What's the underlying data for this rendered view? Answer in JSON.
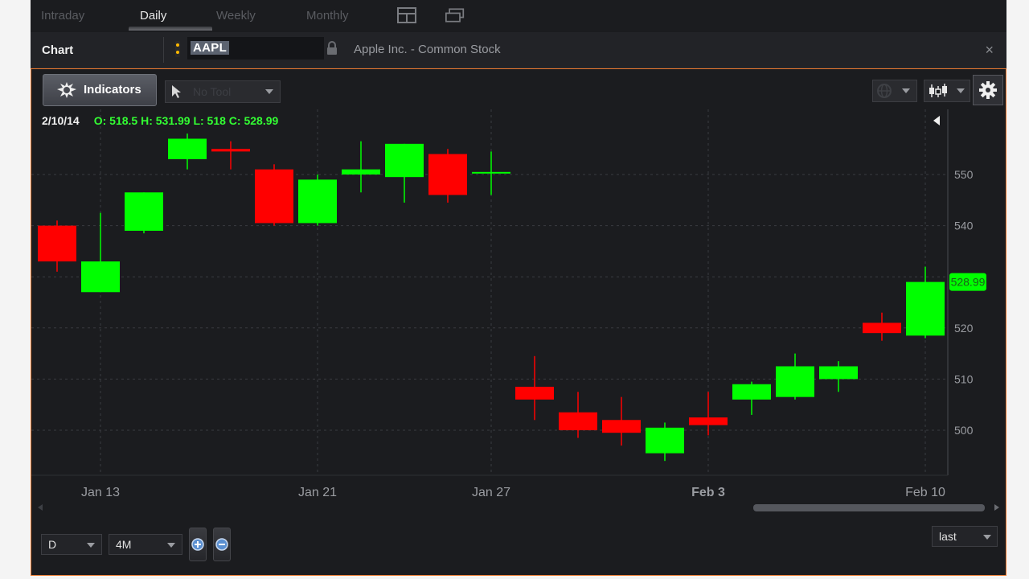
{
  "tabs": [
    "Intraday",
    "Daily",
    "Weekly",
    "Monthly"
  ],
  "active_tab": "Daily",
  "header": {
    "title": "Chart",
    "symbol": "AAPL",
    "description": "Apple Inc. - Common Stock",
    "close": "×"
  },
  "toolbar": {
    "indicators_label": "Indicators",
    "tool_placeholder": "No Tool"
  },
  "readout": {
    "date": "2/10/14",
    "ohlc": "O: 518.5 H: 531.99 L: 518 C: 528.99"
  },
  "footer": {
    "interval": "D",
    "range": "4M",
    "price_type": "last"
  },
  "colors": {
    "up": "#00ff00",
    "down": "#ff0000",
    "accent": "#e8772e",
    "last_badge": "#00ff00"
  },
  "icons": [
    "signal-icon",
    "lock-icon",
    "layout-icon",
    "gear-icon",
    "cursor-icon",
    "zoom-in-icon",
    "zoom-out-icon",
    "candlestick-icon",
    "globe-icon",
    "chevron-down-icon"
  ],
  "chart_data": {
    "type": "candlestick",
    "xlabel": "",
    "ylabel": "",
    "ylim": [
      493,
      557
    ],
    "y_ticks": [
      500,
      510,
      520,
      530,
      540,
      550
    ],
    "y_tick_labels": [
      "500",
      "510",
      "520",
      "",
      "540",
      "550"
    ],
    "last_price_label": "528.99",
    "x_tick_labels": [
      {
        "date": "2014-01-13",
        "label": "Jan 13",
        "bold": false
      },
      {
        "date": "2014-01-21",
        "label": "Jan 21",
        "bold": false
      },
      {
        "date": "2014-01-27",
        "label": "Jan 27",
        "bold": false
      },
      {
        "date": "2014-02-03",
        "label": "Feb 3",
        "bold": true
      },
      {
        "date": "2014-02-10",
        "label": "Feb 10",
        "bold": false
      }
    ],
    "candles": [
      {
        "date": "2014-01-10",
        "o": 540,
        "h": 541,
        "l": 531,
        "c": 533
      },
      {
        "date": "2014-01-13",
        "o": 527,
        "h": 542.5,
        "l": 527,
        "c": 533
      },
      {
        "date": "2014-01-14",
        "o": 539,
        "h": 546.5,
        "l": 538.5,
        "c": 546.5
      },
      {
        "date": "2014-01-15",
        "o": 553,
        "h": 558,
        "l": 551,
        "c": 557
      },
      {
        "date": "2014-01-16",
        "o": 555,
        "h": 556.5,
        "l": 551,
        "c": 554.5
      },
      {
        "date": "2014-01-17",
        "o": 551,
        "h": 552,
        "l": 540,
        "c": 540.5
      },
      {
        "date": "2014-01-21",
        "o": 540.5,
        "h": 550,
        "l": 540,
        "c": 549
      },
      {
        "date": "2014-01-22",
        "o": 550,
        "h": 556.5,
        "l": 546.5,
        "c": 551
      },
      {
        "date": "2014-01-23",
        "o": 549.5,
        "h": 556,
        "l": 544.5,
        "c": 556
      },
      {
        "date": "2014-01-24",
        "o": 554,
        "h": 555,
        "l": 544.5,
        "c": 546
      },
      {
        "date": "2014-01-27",
        "o": 550.5,
        "h": 554.5,
        "l": 546,
        "c": 550.5
      },
      {
        "date": "2014-01-28",
        "o": 508.5,
        "h": 514.5,
        "l": 502,
        "c": 506
      },
      {
        "date": "2014-01-29",
        "o": 503.5,
        "h": 507.5,
        "l": 498.5,
        "c": 500
      },
      {
        "date": "2014-01-30",
        "o": 502,
        "h": 506.5,
        "l": 497,
        "c": 499.5
      },
      {
        "date": "2014-01-31",
        "o": 495.5,
        "h": 501.5,
        "l": 494,
        "c": 500.5
      },
      {
        "date": "2014-02-03",
        "o": 502.5,
        "h": 507.5,
        "l": 499,
        "c": 501
      },
      {
        "date": "2014-02-04",
        "o": 506,
        "h": 509.5,
        "l": 503,
        "c": 509
      },
      {
        "date": "2014-02-05",
        "o": 506.5,
        "h": 515,
        "l": 506,
        "c": 512.5
      },
      {
        "date": "2014-02-06",
        "o": 510,
        "h": 513.5,
        "l": 507.5,
        "c": 512.5
      },
      {
        "date": "2014-02-07",
        "o": 521,
        "h": 523,
        "l": 517.5,
        "c": 519
      },
      {
        "date": "2014-02-10",
        "o": 518.5,
        "h": 531.99,
        "l": 518,
        "c": 528.99
      }
    ]
  }
}
